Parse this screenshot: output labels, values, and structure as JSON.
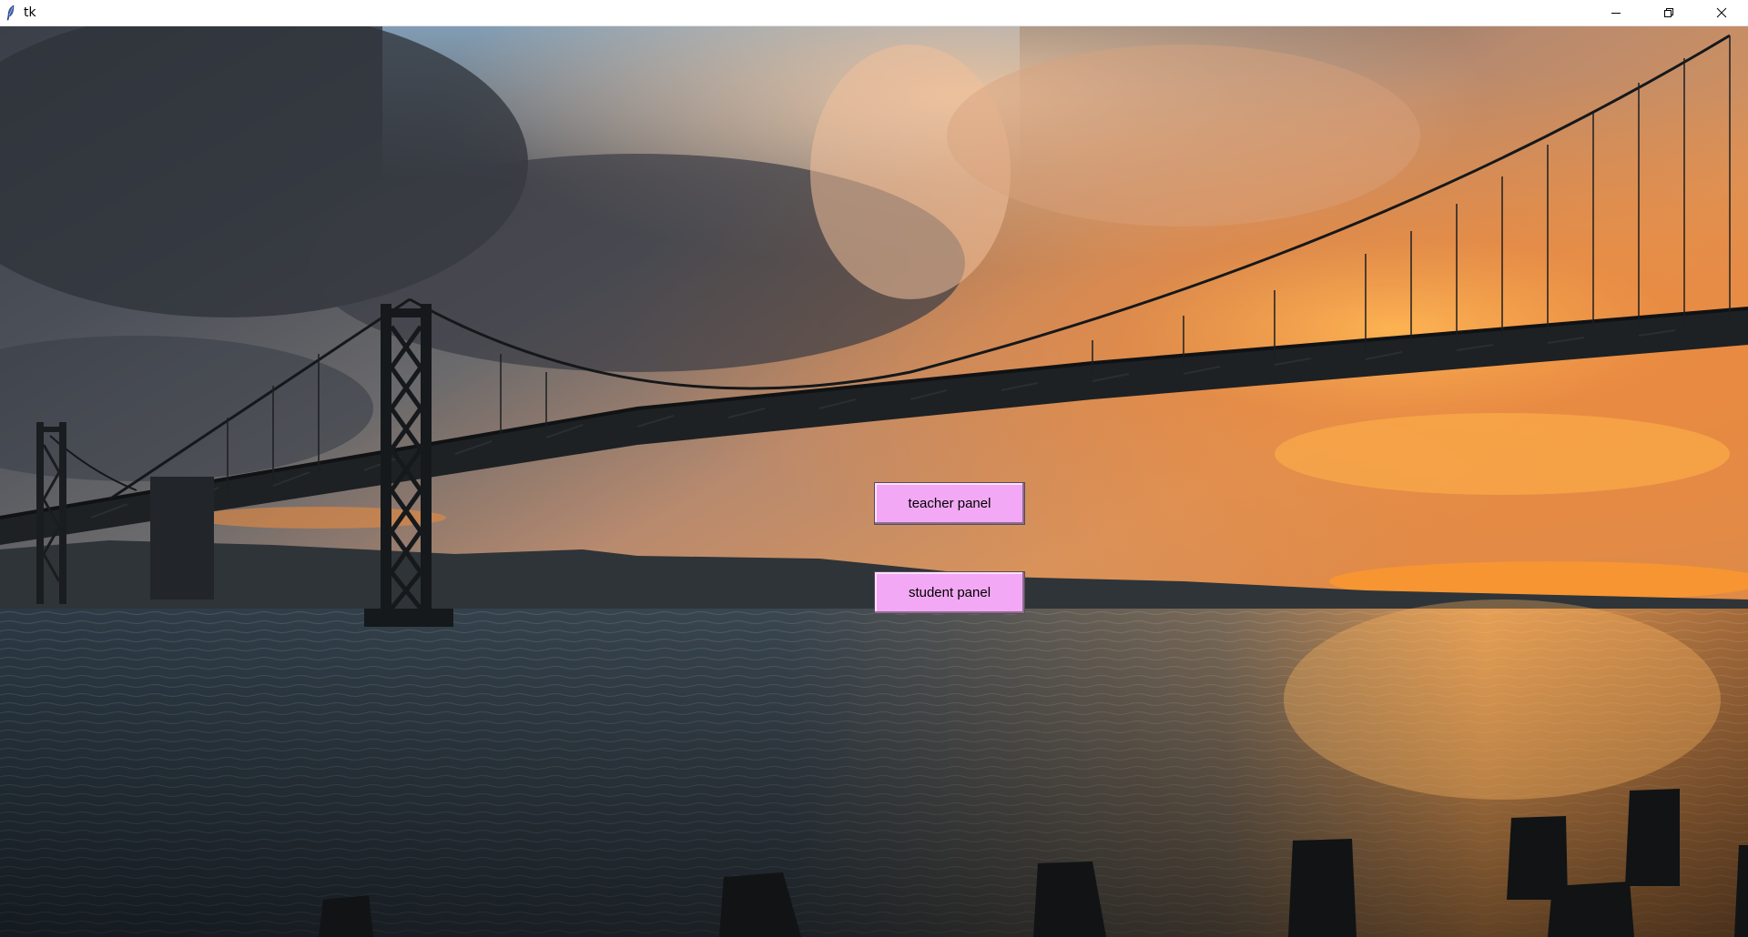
{
  "window": {
    "title": "tk",
    "controls": {
      "minimize_icon": "minimize-icon",
      "maximize_icon": "restore-icon",
      "close_icon": "close-icon"
    }
  },
  "background": {
    "description_icon": "background-photo"
  },
  "buttons": {
    "teacher_label": "teacher panel",
    "student_label": "student panel",
    "color": "#f2a8f4"
  }
}
